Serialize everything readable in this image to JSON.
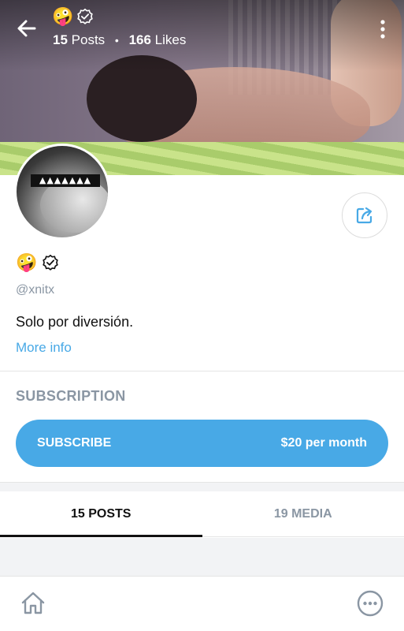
{
  "header": {
    "name_emoji": "🤪",
    "posts_count": "15",
    "posts_label": "Posts",
    "separator": "•",
    "likes_count": "166",
    "likes_label": "Likes"
  },
  "profile": {
    "name_emoji": "🤪",
    "handle": "@xnitx",
    "bio": "Solo por diversión.",
    "more_info_label": "More info",
    "avatar_censor_text": "▲▲▲▲▲▲▲"
  },
  "subscription": {
    "heading": "SUBSCRIPTION",
    "button_label": "SUBSCRIBE",
    "price": "$20 per month"
  },
  "tabs": [
    {
      "label": "15 POSTS",
      "active": true
    },
    {
      "label": "19 MEDIA",
      "active": false
    }
  ],
  "icons": {
    "back": "arrow-left-icon",
    "more": "vertical-dots-icon",
    "verified": "verified-badge-icon",
    "share": "share-icon",
    "home": "home-icon",
    "menu": "more-horizontal-icon"
  },
  "colors": {
    "accent": "#48a9e6",
    "muted_text": "#8a96a3",
    "text": "#111111"
  }
}
